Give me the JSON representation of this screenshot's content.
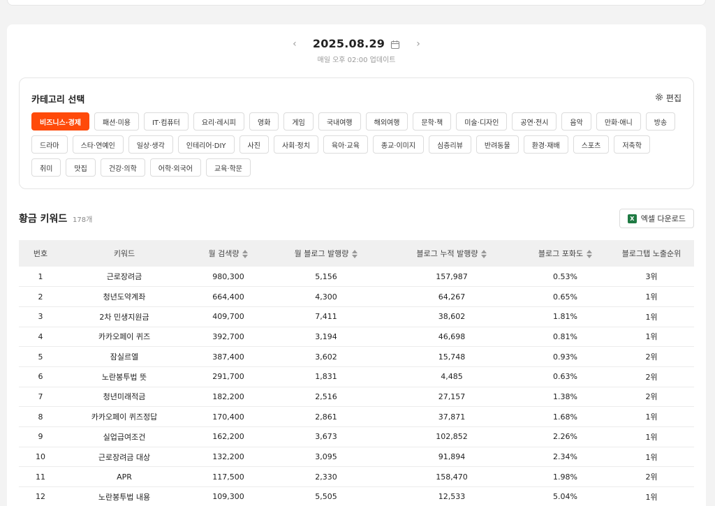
{
  "date_nav": {
    "prev": "‹",
    "date": "2025.08.29",
    "next": "›",
    "update_note": "매일 오후 02:00 업데이트"
  },
  "category": {
    "title": "카테고리 선택",
    "edit_label": "편집",
    "chips": [
      {
        "label": "비즈니스·경제",
        "active": true
      },
      {
        "label": "패션·미용"
      },
      {
        "label": "IT·컴퓨터"
      },
      {
        "label": "요리·레시피"
      },
      {
        "label": "영화"
      },
      {
        "label": "게임"
      },
      {
        "label": "국내여행"
      },
      {
        "label": "해외여행"
      },
      {
        "label": "문학·책"
      },
      {
        "label": "미술·디자인"
      },
      {
        "label": "공연·전시"
      },
      {
        "label": "음악"
      },
      {
        "label": "만화·애니"
      },
      {
        "label": "방송"
      },
      {
        "label": "드라마"
      },
      {
        "label": "스타·연예인"
      },
      {
        "label": "일상·생각"
      },
      {
        "label": "인테리어·DIY"
      },
      {
        "label": "사진"
      },
      {
        "label": "사회·정치"
      },
      {
        "label": "육아·교육"
      },
      {
        "label": "종교·이미지"
      },
      {
        "label": "심층리뷰"
      },
      {
        "label": "반려동물"
      },
      {
        "label": "환경·재배"
      },
      {
        "label": "스포츠"
      },
      {
        "label": "저축학"
      },
      {
        "label": "취미"
      },
      {
        "label": "맛집"
      },
      {
        "label": "건강·의학"
      },
      {
        "label": "어학·외국어"
      },
      {
        "label": "교육·학문"
      }
    ]
  },
  "keywords": {
    "title": "황금 키워드",
    "count": "178개",
    "excel_label": "엑셀 다운로드",
    "excel_icon": "X",
    "columns": [
      "번호",
      "키워드",
      "월 검색량",
      "월 블로그 발행량",
      "블로그 누적 발행량",
      "블로그 포화도",
      "블로그탭 노출순위"
    ],
    "rows": [
      [
        "1",
        "근로장려금",
        "980,300",
        "5,156",
        "157,987",
        "0.53%",
        "3위"
      ],
      [
        "2",
        "청년도약계좌",
        "664,400",
        "4,300",
        "64,267",
        "0.65%",
        "1위"
      ],
      [
        "3",
        "2차 민생지원금",
        "409,700",
        "7,411",
        "38,602",
        "1.81%",
        "1위"
      ],
      [
        "4",
        "카카오페이 퀴즈",
        "392,700",
        "3,194",
        "46,698",
        "0.81%",
        "1위"
      ],
      [
        "5",
        "잠실르엘",
        "387,400",
        "3,602",
        "15,748",
        "0.93%",
        "2위"
      ],
      [
        "6",
        "노란봉투법 뜻",
        "291,700",
        "1,831",
        "4,485",
        "0.63%",
        "2위"
      ],
      [
        "7",
        "청년미래적금",
        "182,200",
        "2,516",
        "27,157",
        "1.38%",
        "2위"
      ],
      [
        "8",
        "카카오페이 퀴즈정답",
        "170,400",
        "2,861",
        "37,871",
        "1.68%",
        "1위"
      ],
      [
        "9",
        "실업급여조건",
        "162,200",
        "3,673",
        "102,852",
        "2.26%",
        "1위"
      ],
      [
        "10",
        "근로장려금 대상",
        "132,200",
        "3,095",
        "91,894",
        "2.34%",
        "1위"
      ],
      [
        "11",
        "APR",
        "117,500",
        "2,330",
        "158,470",
        "1.98%",
        "2위"
      ],
      [
        "12",
        "노란봉투법 내용",
        "109,300",
        "5,505",
        "12,533",
        "5.04%",
        "1위"
      ]
    ]
  }
}
